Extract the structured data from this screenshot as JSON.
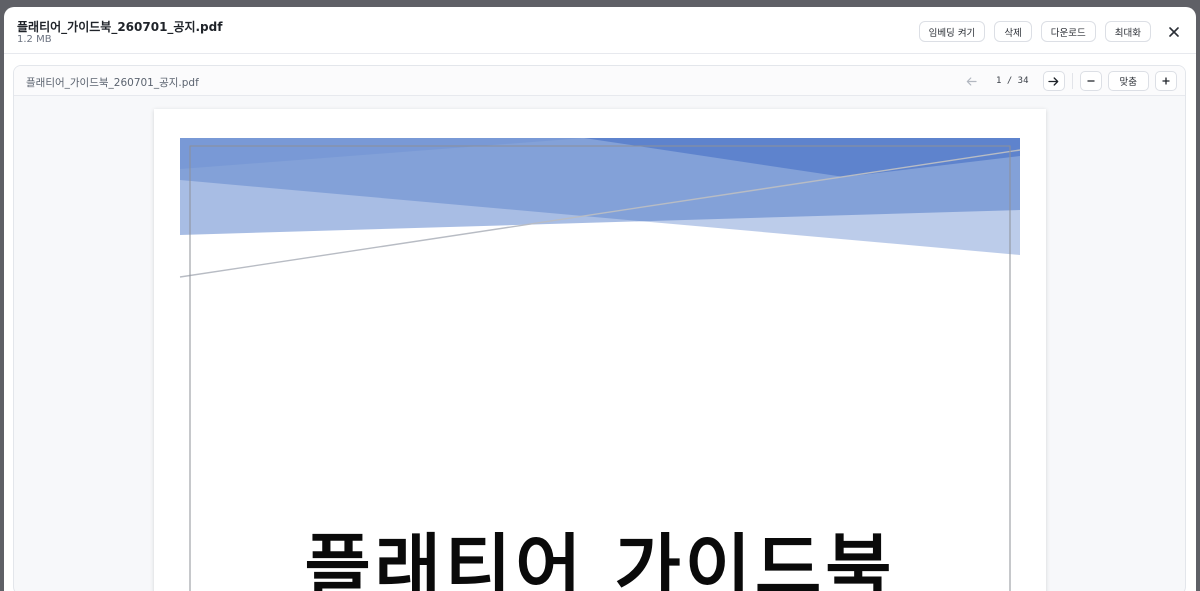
{
  "header": {
    "file_name": "플래티어_가이드북_260701_공지.pdf",
    "file_size": "1.2 MB",
    "actions": {
      "embed_on": "임베딩 켜기",
      "delete": "삭제",
      "download": "다운로드",
      "maximize": "최대화"
    },
    "close_icon": "close-icon"
  },
  "viewer": {
    "file_name": "플래티어_가이드북_260701_공지.pdf",
    "page_indicator": "1 / 34",
    "fit_label": "맞춤",
    "icons": {
      "prev": "arrow-left-icon",
      "next": "arrow-right-icon",
      "zoom_out": "minus-icon",
      "zoom_in": "plus-icon"
    }
  },
  "document": {
    "title": "플래티어 가이드북",
    "colors": {
      "banner_primary": "#3f6cc4",
      "banner_light": "#c8d4ef"
    }
  }
}
